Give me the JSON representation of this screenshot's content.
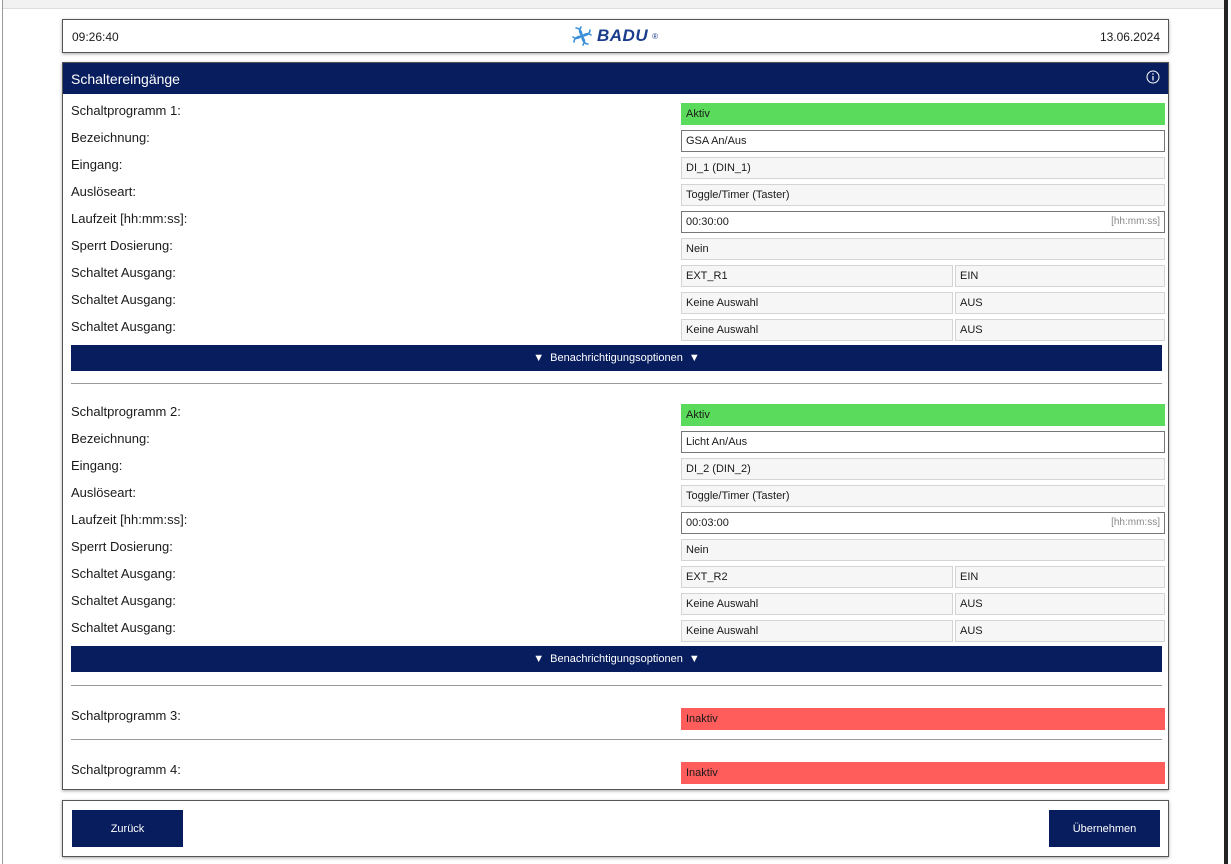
{
  "header": {
    "time": "09:26:40",
    "logo_text": "BADU",
    "logo_reg": "®",
    "date": "13.06.2024"
  },
  "panel": {
    "title": "Schaltereingänge",
    "info_icon": "info-icon"
  },
  "labels": {
    "bezeichnung": "Bezeichnung:",
    "eingang": "Eingang:",
    "ausloeseart": "Auslöseart:",
    "laufzeit": "Laufzeit [hh:mm:ss]:",
    "sperrt": "Sperrt Dosierung:",
    "schaltet": "Schaltet Ausgang:",
    "unit": "[hh:mm:ss]",
    "notify": "Benachrichtigungsoptionen"
  },
  "programs": [
    {
      "label": "Schaltprogramm 1:",
      "status": "Aktiv",
      "bezeichnung": "GSA An/Aus",
      "eingang": "DI_1 (DIN_1)",
      "ausloeseart": "Toggle/Timer (Taster)",
      "laufzeit": "00:30:00",
      "sperrt": "Nein",
      "outputs": [
        {
          "name": "EXT_R1",
          "state": "EIN"
        },
        {
          "name": "Keine Auswahl",
          "state": "AUS"
        },
        {
          "name": "Keine Auswahl",
          "state": "AUS"
        }
      ]
    },
    {
      "label": "Schaltprogramm 2:",
      "status": "Aktiv",
      "bezeichnung": "Licht An/Aus",
      "eingang": "DI_2 (DIN_2)",
      "ausloeseart": "Toggle/Timer (Taster)",
      "laufzeit": "00:03:00",
      "sperrt": "Nein",
      "outputs": [
        {
          "name": "EXT_R2",
          "state": "EIN"
        },
        {
          "name": "Keine Auswahl",
          "state": "AUS"
        },
        {
          "name": "Keine Auswahl",
          "state": "AUS"
        }
      ]
    },
    {
      "label": "Schaltprogramm 3:",
      "status": "Inaktiv"
    },
    {
      "label": "Schaltprogramm 4:",
      "status": "Inaktiv"
    }
  ],
  "footer": {
    "back_label": "Zurück",
    "apply_label": "Übernehmen"
  },
  "colors": {
    "navy": "#081d5e",
    "active": "#5bdb5b",
    "inactive": "#ff5c5c"
  }
}
